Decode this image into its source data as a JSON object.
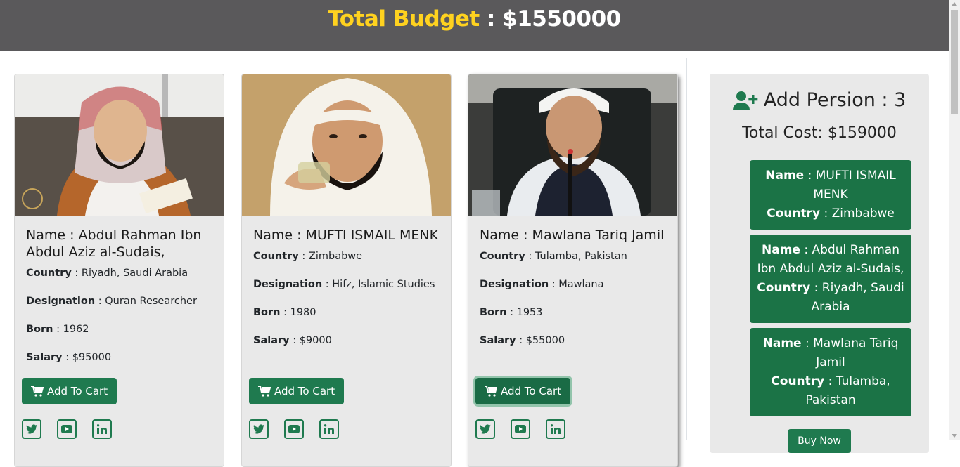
{
  "header": {
    "label": "Total Budget",
    "separator": " : ",
    "value": "$1550000"
  },
  "cards": [
    {
      "name_prefix": "Name : ",
      "name": "Abdul Rahman Ibn Abdul Aziz al-Sudais,",
      "country_label": "Country",
      "country": "Riyadh, Saudi Arabia",
      "designation_label": "Designation",
      "designation": "Quran Researcher",
      "born_label": "Born",
      "born": "1962",
      "salary_label": "Salary",
      "salary": "$95000",
      "button": "Add To Cart"
    },
    {
      "name_prefix": "Name : ",
      "name": "MUFTI ISMAIL MENK",
      "country_label": "Country",
      "country": "Zimbabwe",
      "designation_label": "Designation",
      "designation": "Hifz, Islamic Studies",
      "born_label": "Born",
      "born": "1980",
      "salary_label": "Salary",
      "salary": "$9000",
      "button": "Add To Cart"
    },
    {
      "name_prefix": "Name : ",
      "name": "Mawlana Tariq Jamil",
      "country_label": "Country",
      "country": "Tulamba, Pakistan",
      "designation_label": "Designation",
      "designation": "Mawlana",
      "born_label": "Born",
      "born": "1953",
      "salary_label": "Salary",
      "salary": "$55000",
      "button": "Add To Cart"
    }
  ],
  "sep": " : ",
  "panel": {
    "title": "Add Persion : 3",
    "cost": "Total Cost: $159000",
    "selected": [
      {
        "name_label": "Name",
        "name": "MUFTI ISMAIL MENK",
        "country_label": "Country",
        "country": "Zimbabwe"
      },
      {
        "name_label": "Name",
        "name": "Abdul Rahman Ibn Abdul Aziz al-Sudais,",
        "country_label": "Country",
        "country": "Riyadh, Saudi Arabia"
      },
      {
        "name_label": "Name",
        "name": "Mawlana Tariq Jamil",
        "country_label": "Country",
        "country": "Tulamba, Pakistan"
      }
    ],
    "buy_label": "Buy Now"
  },
  "colors": {
    "header_bg": "#5a595b",
    "accent_yellow": "#ffd21f",
    "brand_green": "#1f7a4f",
    "panel_bg": "#e9e9e9"
  },
  "icons": {
    "cart": "cart-icon",
    "twitter": "twitter-icon",
    "youtube": "youtube-icon",
    "linkedin": "linkedin-icon",
    "add_user": "user-plus-icon"
  }
}
